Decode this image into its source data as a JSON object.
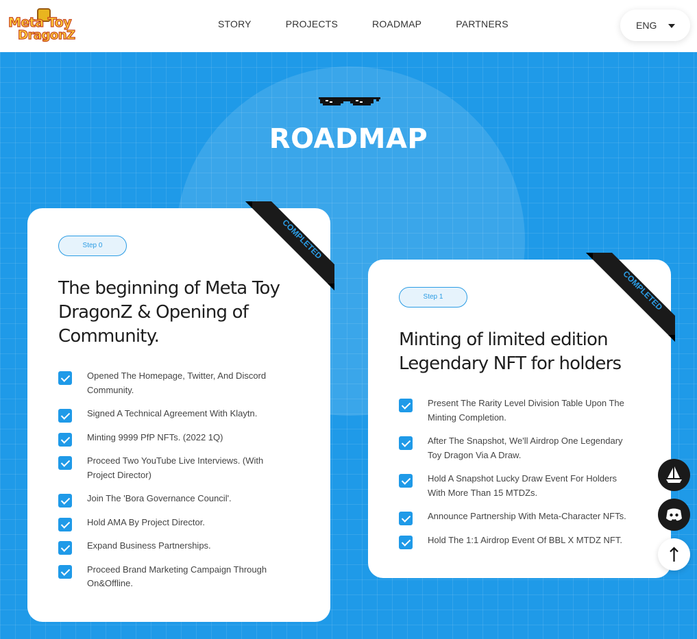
{
  "header": {
    "logo_line1": "Meta Toy",
    "logo_line2": "DragonZ",
    "nav": [
      "STORY",
      "PROJECTS",
      "ROADMAP",
      "PARTNERS"
    ],
    "language": "ENG"
  },
  "section": {
    "title": "ROADMAP"
  },
  "cards": [
    {
      "step": "Step 0",
      "ribbon": "COMPLETED",
      "title": "The beginning of Meta Toy DragonZ & Opening of Community.",
      "items": [
        "Opened The Homepage, Twitter, And Discord Community.",
        "Signed A Technical Agreement With Klaytn.",
        "Minting 9999 PfP NFTs. (2022 1Q)",
        "Proceed Two YouTube Live Interviews. (With Project Director)",
        "Join The 'Bora Governance Council'.",
        "Hold AMA By Project Director.",
        "Expand Business Partnerships.",
        "Proceed Brand Marketing Campaign Through On&Offline."
      ]
    },
    {
      "step": "Step 1",
      "ribbon": "COMPLETED",
      "title": "Minting of limited edition Legendary NFT for holders",
      "items": [
        "Present The Rarity Level Division Table Upon The Minting Completion.",
        "After The Snapshot, We'll Airdrop One Legendary Toy Dragon Via A Draw.",
        "Hold A Snapshot Lucky Draw Event For Holders With More Than 15 MTDZs.",
        "Announce Partnership With Meta-Character NFTs.",
        "Hold The 1:1 Airdrop Event Of BBL X MTDZ NFT."
      ]
    }
  ],
  "floating": {
    "icons": [
      "opensea-icon",
      "discord-icon",
      "arrow-up-icon"
    ]
  },
  "colors": {
    "background": "#1f9ae8",
    "accent": "#2b9ce4",
    "ribbon": "#1a1a1a"
  }
}
